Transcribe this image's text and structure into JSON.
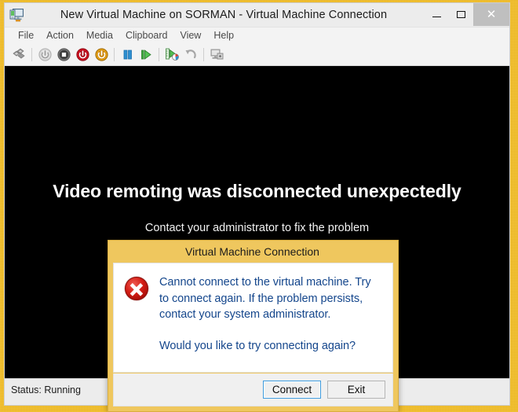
{
  "window": {
    "title": "New Virtual Machine on SORMAN - Virtual Machine Connection",
    "icon": "virtual-machine-icon",
    "caption": {
      "minimize_label": "–",
      "maximize_label": "□",
      "close_label": "✕"
    }
  },
  "menubar": {
    "items": [
      {
        "label": "File"
      },
      {
        "label": "Action"
      },
      {
        "label": "Media"
      },
      {
        "label": "Clipboard"
      },
      {
        "label": "View"
      },
      {
        "label": "Help"
      }
    ]
  },
  "toolbar": {
    "buttons": [
      {
        "name": "ctrl-alt-delete-icon",
        "title": "Ctrl+Alt+Delete"
      },
      {
        "name": "start-icon",
        "title": "Start"
      },
      {
        "name": "turn-off-icon",
        "title": "Turn Off"
      },
      {
        "name": "shut-down-icon",
        "title": "Shut Down"
      },
      {
        "name": "save-icon",
        "title": "Save"
      },
      {
        "name": "pause-icon",
        "title": "Pause"
      },
      {
        "name": "reset-icon",
        "title": "Reset"
      },
      {
        "name": "checkpoint-icon",
        "title": "Checkpoint"
      },
      {
        "name": "revert-icon",
        "title": "Revert"
      },
      {
        "name": "enhanced-session-icon",
        "title": "Enhanced Session"
      }
    ]
  },
  "vmscreen": {
    "headline": "Video remoting was disconnected unexpectedly",
    "subtext": "Contact your administrator to fix the problem",
    "background_color": "#000000"
  },
  "statusbar": {
    "status_text": "Status: Running"
  },
  "dialog": {
    "title": "Virtual Machine Connection",
    "icon": "error-icon",
    "message_1": "Cannot connect to the virtual machine. Try to connect again. If the problem persists, contact your system administrator.",
    "message_2": "Would you like to try connecting again?",
    "buttons": [
      {
        "label": "Connect",
        "default": true
      },
      {
        "label": "Exit",
        "default": false
      }
    ],
    "title_bar_color": "#efc75e",
    "text_color": "#14468c"
  },
  "desktop": {
    "background_color": "#f6c026"
  }
}
